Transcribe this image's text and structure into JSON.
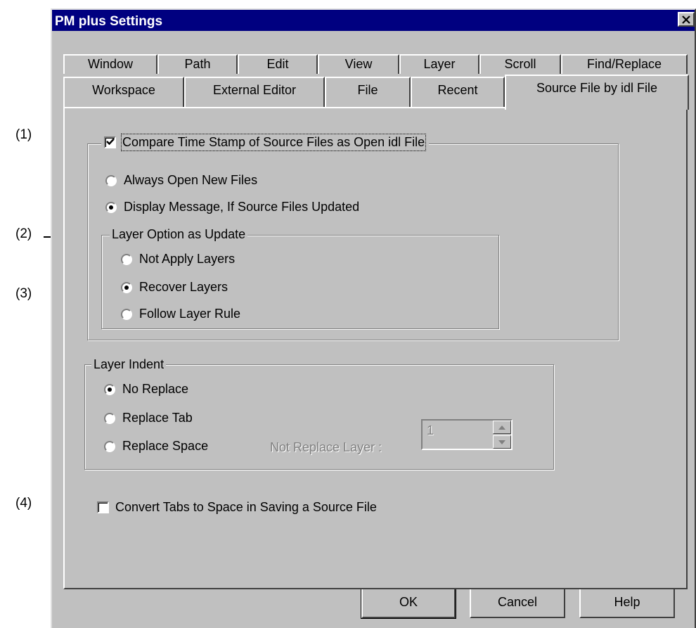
{
  "annotations": [
    "(1)",
    "(2)",
    "(3)",
    "(4)"
  ],
  "window": {
    "title": "PM plus Settings"
  },
  "tabs": {
    "row1": [
      "Window",
      "Path",
      "Edit",
      "View",
      "Layer",
      "Scroll",
      "Find/Replace"
    ],
    "row2": [
      "Workspace",
      "External Editor",
      "File",
      "Recent",
      "Source File by idl File"
    ],
    "active": "Source File by idl File"
  },
  "compare": {
    "checkbox_label": "Compare Time Stamp of Source Files as Open idl File",
    "checked": true,
    "options": [
      {
        "label": "Always Open New Files",
        "selected": false
      },
      {
        "label": "Display Message, If Source Files Updated",
        "selected": true
      }
    ]
  },
  "layer_option": {
    "title": "Layer Option as Update",
    "options": [
      {
        "label": "Not Apply Layers",
        "selected": false
      },
      {
        "label": "Recover Layers",
        "selected": true
      },
      {
        "label": "Follow Layer Rule",
        "selected": false
      }
    ]
  },
  "layer_indent": {
    "title": "Layer Indent",
    "options": [
      {
        "label": "No Replace",
        "selected": true
      },
      {
        "label": "Replace Tab",
        "selected": false
      },
      {
        "label": "Replace Space",
        "selected": false
      }
    ],
    "not_replace_label": "Not Replace Layer :",
    "not_replace_value": "1"
  },
  "convert": {
    "checkbox_label": "Convert Tabs to Space in Saving a Source File",
    "checked": false
  },
  "buttons": {
    "ok": "OK",
    "cancel": "Cancel",
    "help": "Help"
  }
}
